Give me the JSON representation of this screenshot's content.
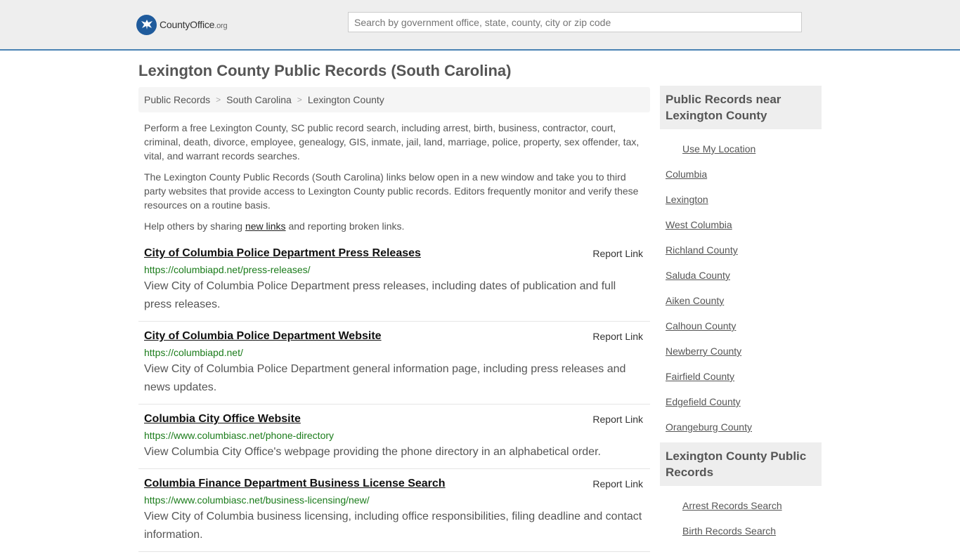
{
  "header": {
    "logo_main": "CountyOffice",
    "logo_suffix": ".org",
    "search_placeholder": "Search by government office, state, county, city or zip code"
  },
  "page_title": "Lexington County Public Records (South Carolina)",
  "breadcrumb": [
    "Public Records",
    "South Carolina",
    "Lexington County"
  ],
  "intro": {
    "p1": "Perform a free Lexington County, SC public record search, including arrest, birth, business, contractor, court, criminal, death, divorce, employee, genealogy, GIS, inmate, jail, land, marriage, police, property, sex offender, tax, vital, and warrant records searches.",
    "p2": "The Lexington County Public Records (South Carolina) links below open in a new window and take you to third party websites that provide access to Lexington County public records. Editors frequently monitor and verify these resources on a routine basis.",
    "p3_before": "Help others by sharing ",
    "p3_link": "new links",
    "p3_after": " and reporting broken links."
  },
  "results": [
    {
      "title": "City of Columbia Police Department Press Releases",
      "report": "Report Link",
      "url": "https://columbiapd.net/press-releases/",
      "desc": "View City of Columbia Police Department press releases, including dates of publication and full press releases."
    },
    {
      "title": "City of Columbia Police Department Website",
      "report": "Report Link",
      "url": "https://columbiapd.net/",
      "desc": "View City of Columbia Police Department general information page, including press releases and news updates."
    },
    {
      "title": "Columbia City Office Website",
      "report": "Report Link",
      "url": "https://www.columbiasc.net/phone-directory",
      "desc": "View Columbia City Office's webpage providing the phone directory in an alphabetical order."
    },
    {
      "title": "Columbia Finance Department Business License Search",
      "report": "Report Link",
      "url": "https://www.columbiasc.net/business-licensing/new/",
      "desc": "View City of Columbia business licensing, including office responsibilities, filing deadline and contact information."
    }
  ],
  "sidebar": {
    "nearby_title": "Public Records near Lexington County",
    "use_location": "Use My Location",
    "nearby": [
      "Columbia",
      "Lexington",
      "West Columbia",
      "Richland County",
      "Saluda County",
      "Aiken County",
      "Calhoun County",
      "Newberry County",
      "Fairfield County",
      "Edgefield County",
      "Orangeburg County"
    ],
    "records_title": "Lexington County Public Records",
    "records": [
      "Arrest Records Search",
      "Birth Records Search"
    ]
  },
  "colors": {
    "accent": "#4a82b4",
    "url_green": "#1b7c1b",
    "logo_blue": "#1f5b9c"
  }
}
